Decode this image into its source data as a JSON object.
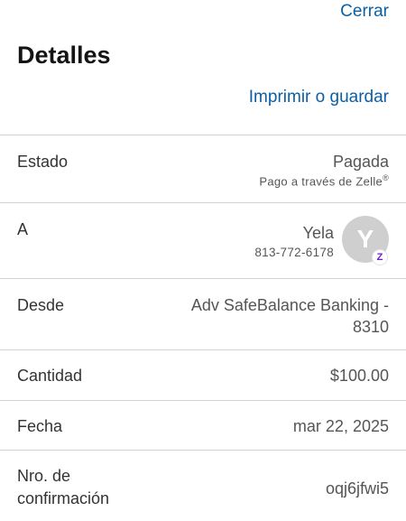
{
  "header": {
    "close_label": "Cerrar",
    "title": "Detalles",
    "print_label": "Imprimir o guardar"
  },
  "rows": {
    "status": {
      "label": "Estado",
      "value": "Pagada",
      "sub": "Pago a través de Zelle",
      "sub_mark": "®"
    },
    "to": {
      "label": "A",
      "name": "Yela",
      "phone": "813-772-6178",
      "avatar_initial": "Y",
      "badge_letter": "Z"
    },
    "from": {
      "label": "Desde",
      "value_line1": "Adv SafeBalance Banking -",
      "value_line2": "8310"
    },
    "amount": {
      "label": "Cantidad",
      "value": "$100.00"
    },
    "date": {
      "label": "Fecha",
      "value": "mar 22, 2025"
    },
    "confirmation": {
      "label_line1": "Nro. de",
      "label_line2": "confirmación",
      "value": "oqj6jfwi5"
    }
  },
  "colors": {
    "link": "#0b5fa5",
    "divider": "#d3d3d3",
    "avatar_bg": "#cfcfcf",
    "zelle_purple": "#6d1ed4"
  }
}
